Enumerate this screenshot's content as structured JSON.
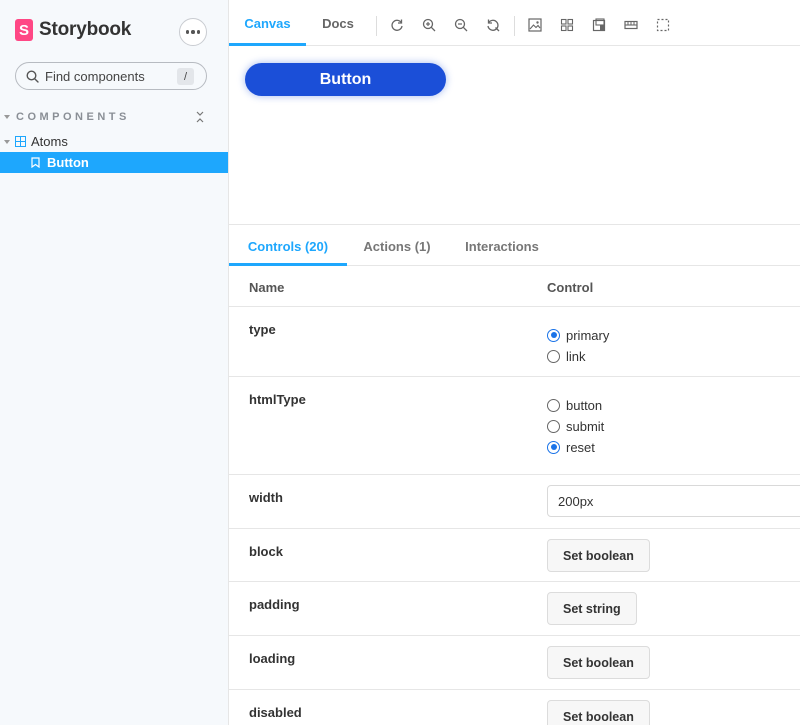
{
  "sidebar": {
    "brand": "Storybook",
    "brand_logo": "S",
    "search_placeholder": "Find components",
    "search_shortcut": "/",
    "section_title": "COMPONENTS",
    "tree": {
      "group": "Atoms",
      "story": "Button"
    }
  },
  "toolbar": {
    "tabs": [
      "Canvas",
      "Docs"
    ],
    "icons": [
      "reload-icon",
      "zoom-in-icon",
      "zoom-out-icon",
      "zoom-reset-icon",
      "background-icon",
      "grid-icon",
      "viewport-icon",
      "measure-icon",
      "outline-icon"
    ]
  },
  "canvas": {
    "demo_button_label": "Button"
  },
  "addons": {
    "tabs": [
      "Controls (20)",
      "Actions (1)",
      "Interactions"
    ]
  },
  "controls": {
    "header_name": "Name",
    "header_control": "Control",
    "type": {
      "name": "type",
      "options": [
        "primary",
        "link"
      ],
      "selected": "primary"
    },
    "htmlType": {
      "name": "htmlType",
      "options": [
        "button",
        "submit",
        "reset"
      ],
      "selected": "reset"
    },
    "width": {
      "name": "width",
      "value": "200px"
    },
    "block": {
      "name": "block",
      "button": "Set boolean"
    },
    "padding": {
      "name": "padding",
      "button": "Set string"
    },
    "loading": {
      "name": "loading",
      "button": "Set boolean"
    },
    "disabled": {
      "name": "disabled",
      "button": "Set boolean"
    }
  },
  "colors": {
    "accent": "#1ea7fd",
    "brand": "#ff4785",
    "demo_button": "#1b4fd8"
  }
}
